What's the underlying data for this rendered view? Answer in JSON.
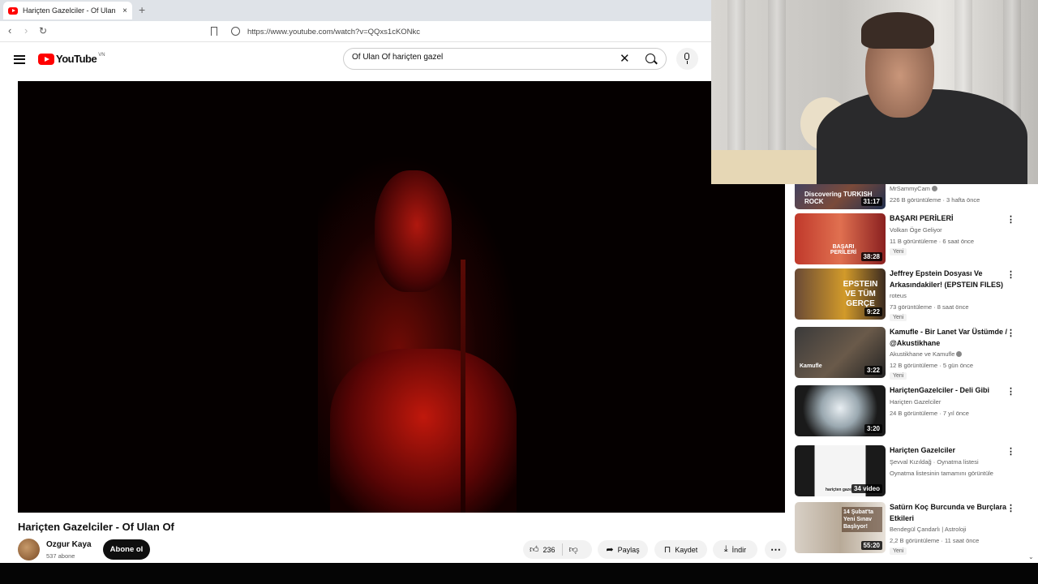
{
  "browser": {
    "tab_title": "Hariçten Gazelciler - Of Ulan Of",
    "new_tab": "+",
    "tab_close": "×",
    "url": "https://www.youtube.com/watch?v=QQxs1cKONkc"
  },
  "header": {
    "logo_text": "YouTube",
    "country_code": "VN",
    "search_value": "Of Ulan Of hariçten gazel"
  },
  "video": {
    "title": "Hariçten Gazelciler - Of Ulan Of",
    "channel": "Ozgur Kaya",
    "subscribers": "537 abone",
    "subscribe_label": "Abone ol",
    "likes": "236",
    "share_label": "Paylaş",
    "save_label": "Kaydet",
    "download_label": "İndir"
  },
  "recommendations": [
    {
      "title": "",
      "channel": "MrSammyCam",
      "meta": "226 B görüntüleme · 3 hafta önce",
      "duration": "31:17",
      "thumb_text": "Discovering TURKISH ROCK",
      "badge": ""
    },
    {
      "title": "BAŞARI PERİLERİ",
      "channel": "Volkan Öge Geliyor",
      "meta": "11 B görüntüleme · 6 saat önce",
      "duration": "38:28",
      "thumb_text": "BAŞARI PERİLERİ",
      "badge": "Yeni"
    },
    {
      "title": "Jeffrey Epstein Dosyası Ve Arkasındakiler! (EPSTEIN FILES)",
      "channel": "roteus",
      "meta": "73 görüntüleme · 8 saat önce",
      "duration": "9:22",
      "thumb_text": "EPSTEIN VE TÜM GERÇE",
      "badge": "Yeni"
    },
    {
      "title": "Kamufle - Bir Lanet Var Üstümde / @Akustikhane",
      "channel": "Akustikhane ve Kamufle",
      "meta": "12 B görüntüleme · 5 gün önce",
      "duration": "3:22",
      "thumb_text": "Kamufle",
      "badge": "Yeni"
    },
    {
      "title": "HariçtenGazelciler - Deli Gibi",
      "channel": "Hariçten Gazelciler",
      "meta": "24 B görüntüleme · 7 yıl önce",
      "duration": "3:20",
      "thumb_text": "",
      "badge": ""
    },
    {
      "title": "Hariçten Gazelciler",
      "channel": "Şevval Kızıldağ · Oynatma listesi",
      "meta": "Oynatma listesinin tamamını görüntüle",
      "duration": "34 video",
      "thumb_text": "hariçten gazel",
      "badge": ""
    },
    {
      "title": "Satürn Koç Burcunda ve Burçlara Etkileri",
      "channel": "Bendegül Çandarlı | Astroloji",
      "meta": "2,2 B görüntüleme · 11 saat önce",
      "duration": "55:20",
      "thumb_text": "14 Şubat'ta Yeni Sınav Başlıyor!",
      "badge": "Yeni"
    }
  ]
}
